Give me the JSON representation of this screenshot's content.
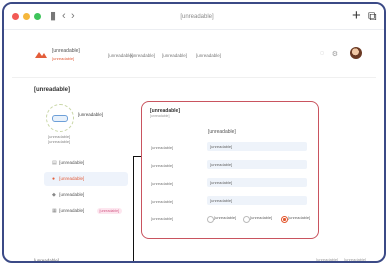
{
  "window": {
    "url": "[unreadable]",
    "new_tab_glyph": "+",
    "tabs_glyph": "⧉"
  },
  "header": {
    "brand_name": "[unreadable]",
    "brand_sub": "[unreadable]",
    "nav": [
      "[unreadable]",
      "[unreadable]",
      "[unreadable]",
      "[unreadable]"
    ]
  },
  "page": {
    "title": "[unreadable]"
  },
  "profile": {
    "company_name": "[unreadable]",
    "meta_line1": "[unreadable]",
    "meta_line2": "[unreadable]"
  },
  "sidebar": {
    "items": [
      {
        "label": "[unreadable]",
        "icon": "document-icon",
        "active": false,
        "badge": ""
      },
      {
        "label": "[unreadable]",
        "icon": "user-icon",
        "active": true,
        "badge": ""
      },
      {
        "label": "[unreadable]",
        "icon": "chart-icon",
        "active": false,
        "badge": ""
      },
      {
        "label": "[unreadable]",
        "icon": "grid-icon",
        "active": false,
        "badge": "[unreadable]"
      }
    ]
  },
  "form": {
    "panel_title": "[unreadable]",
    "panel_subtitle": "[unreadable]",
    "heading": "[unreadable]",
    "fields": [
      {
        "label": "[unreadable]",
        "value": "[unreadable]"
      },
      {
        "label": "[unreadable]",
        "value": "[unreadable]"
      },
      {
        "label": "[unreadable]",
        "value": "[unreadable]"
      },
      {
        "label": "[unreadable]",
        "value": "[unreadable]"
      }
    ],
    "radio_label": "[unreadable]",
    "radio_options": [
      "[unreadable]",
      "[unreadable]",
      "[unreadable]"
    ],
    "radio_selected_index": 2
  },
  "footer": {
    "left": "[unreadable]",
    "right": [
      "[unreadable]",
      "[unreadable]"
    ]
  },
  "colors": {
    "accent": "#e35d3a",
    "panel_border": "#c9545f",
    "frame_border": "#3b4a86",
    "input_bg": "#eef3fa",
    "active_item_bg": "#eef3fb"
  }
}
